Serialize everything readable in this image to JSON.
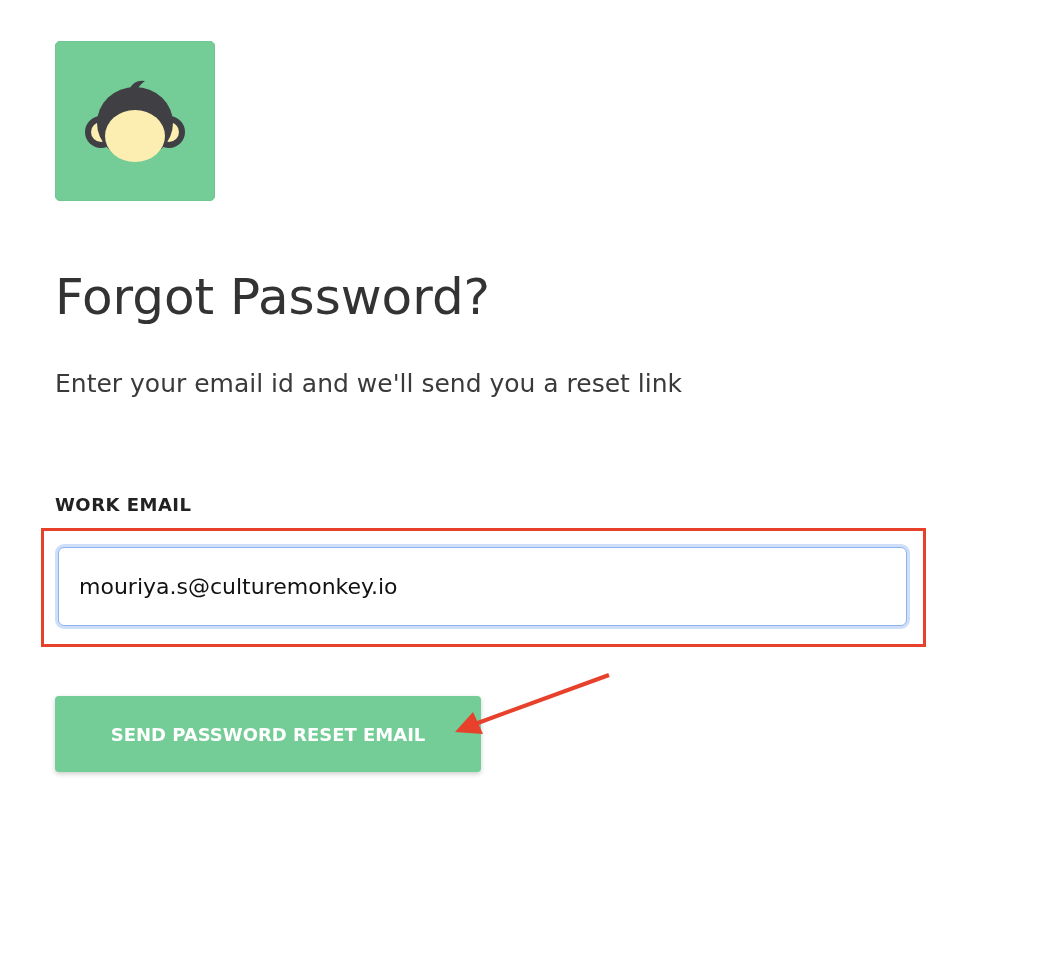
{
  "logo": {
    "kind": "monkey"
  },
  "title": "Forgot Password?",
  "subtitle": "Enter your email id and we'll send you a reset link",
  "email_field": {
    "label": "WORK EMAIL",
    "value": "mouriya.s@culturemonkey.io",
    "focused": true
  },
  "submit_button": {
    "label": "SEND PASSWORD RESET EMAIL"
  },
  "annotations": {
    "highlight_box": true,
    "arrow": true
  }
}
